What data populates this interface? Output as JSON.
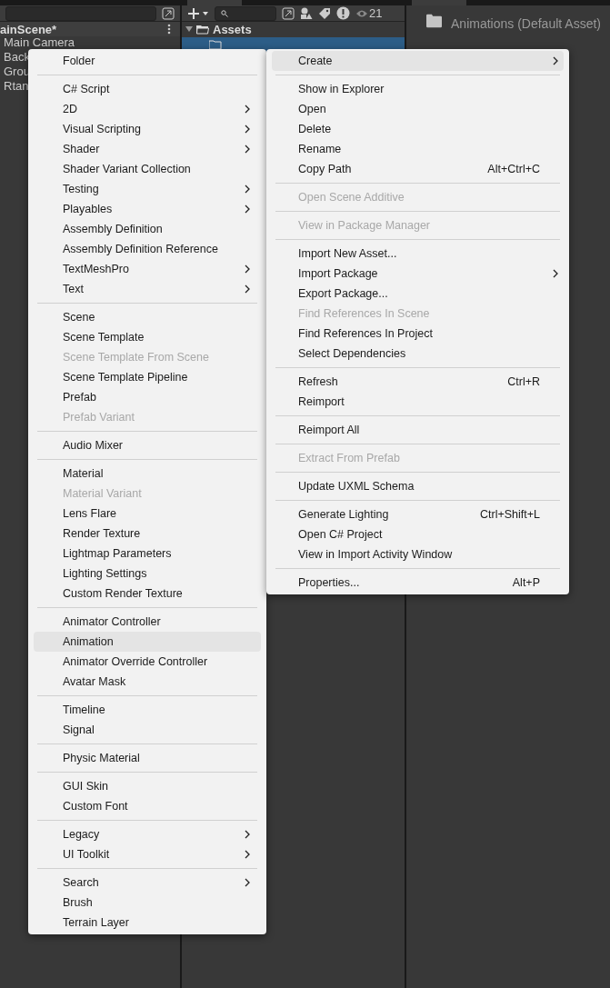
{
  "hierarchy": {
    "scene": "ainScene*",
    "items": [
      "Main Camera",
      "Back",
      "Grou",
      "Rtan"
    ]
  },
  "project": {
    "hidden_count": "21",
    "tree": [
      {
        "label": "Assets",
        "expanded": true,
        "selected": false,
        "children": [
          {
            "selected": true
          }
        ]
      }
    ]
  },
  "inspector": {
    "title": "Animations (Default Asset)"
  },
  "context_menu": {
    "sections": [
      [
        {
          "label": "Create",
          "disabled": false,
          "submenu": true,
          "selected": true
        }
      ],
      [
        {
          "label": "Show in Explorer",
          "disabled": false,
          "submenu": false,
          "selected": false
        },
        {
          "label": "Open",
          "disabled": false,
          "submenu": false,
          "selected": false
        },
        {
          "label": "Delete",
          "disabled": false,
          "submenu": false,
          "selected": false
        },
        {
          "label": "Rename",
          "disabled": false,
          "submenu": false,
          "selected": false
        },
        {
          "label": "Copy Path",
          "shortcut": "Alt+Ctrl+C",
          "disabled": false,
          "submenu": false,
          "selected": false
        }
      ],
      [
        {
          "label": "Open Scene Additive",
          "disabled": true,
          "submenu": false,
          "selected": false
        }
      ],
      [
        {
          "label": "View in Package Manager",
          "disabled": true,
          "submenu": false,
          "selected": false
        }
      ],
      [
        {
          "label": "Import New Asset...",
          "disabled": false,
          "submenu": false,
          "selected": false
        },
        {
          "label": "Import Package",
          "disabled": false,
          "submenu": true,
          "selected": false
        },
        {
          "label": "Export Package...",
          "disabled": false,
          "submenu": false,
          "selected": false
        },
        {
          "label": "Find References In Scene",
          "disabled": true,
          "submenu": false,
          "selected": false
        },
        {
          "label": "Find References In Project",
          "disabled": false,
          "submenu": false,
          "selected": false
        },
        {
          "label": "Select Dependencies",
          "disabled": false,
          "submenu": false,
          "selected": false
        }
      ],
      [
        {
          "label": "Refresh",
          "shortcut": "Ctrl+R",
          "disabled": false,
          "submenu": false,
          "selected": false
        },
        {
          "label": "Reimport",
          "disabled": false,
          "submenu": false,
          "selected": false
        }
      ],
      [
        {
          "label": "Reimport All",
          "disabled": false,
          "submenu": false,
          "selected": false
        }
      ],
      [
        {
          "label": "Extract From Prefab",
          "disabled": true,
          "submenu": false,
          "selected": false
        }
      ],
      [
        {
          "label": "Update UXML Schema",
          "disabled": false,
          "submenu": false,
          "selected": false
        }
      ],
      [
        {
          "label": "Generate Lighting",
          "shortcut": "Ctrl+Shift+L",
          "disabled": false,
          "submenu": false,
          "selected": false
        },
        {
          "label": "Open C# Project",
          "disabled": false,
          "submenu": false,
          "selected": false
        },
        {
          "label": "View in Import Activity Window",
          "disabled": false,
          "submenu": false,
          "selected": false
        }
      ],
      [
        {
          "label": "Properties...",
          "shortcut": "Alt+P",
          "disabled": false,
          "submenu": false,
          "selected": false
        }
      ]
    ]
  },
  "create_submenu": {
    "sections": [
      [
        {
          "label": "Folder",
          "disabled": false,
          "submenu": false,
          "selected": false
        }
      ],
      [
        {
          "label": "C# Script",
          "disabled": false,
          "submenu": false,
          "selected": false
        },
        {
          "label": "2D",
          "disabled": false,
          "submenu": true,
          "selected": false
        },
        {
          "label": "Visual Scripting",
          "disabled": false,
          "submenu": true,
          "selected": false
        },
        {
          "label": "Shader",
          "disabled": false,
          "submenu": true,
          "selected": false
        },
        {
          "label": "Shader Variant Collection",
          "disabled": false,
          "submenu": false,
          "selected": false
        },
        {
          "label": "Testing",
          "disabled": false,
          "submenu": true,
          "selected": false
        },
        {
          "label": "Playables",
          "disabled": false,
          "submenu": true,
          "selected": false
        },
        {
          "label": "Assembly Definition",
          "disabled": false,
          "submenu": false,
          "selected": false
        },
        {
          "label": "Assembly Definition Reference",
          "disabled": false,
          "submenu": false,
          "selected": false
        },
        {
          "label": "TextMeshPro",
          "disabled": false,
          "submenu": true,
          "selected": false
        },
        {
          "label": "Text",
          "disabled": false,
          "submenu": true,
          "selected": false
        }
      ],
      [
        {
          "label": "Scene",
          "disabled": false,
          "submenu": false,
          "selected": false
        },
        {
          "label": "Scene Template",
          "disabled": false,
          "submenu": false,
          "selected": false
        },
        {
          "label": "Scene Template From Scene",
          "disabled": true,
          "submenu": false,
          "selected": false
        },
        {
          "label": "Scene Template Pipeline",
          "disabled": false,
          "submenu": false,
          "selected": false
        },
        {
          "label": "Prefab",
          "disabled": false,
          "submenu": false,
          "selected": false
        },
        {
          "label": "Prefab Variant",
          "disabled": true,
          "submenu": false,
          "selected": false
        }
      ],
      [
        {
          "label": "Audio Mixer",
          "disabled": false,
          "submenu": false,
          "selected": false
        }
      ],
      [
        {
          "label": "Material",
          "disabled": false,
          "submenu": false,
          "selected": false
        },
        {
          "label": "Material Variant",
          "disabled": true,
          "submenu": false,
          "selected": false
        },
        {
          "label": "Lens Flare",
          "disabled": false,
          "submenu": false,
          "selected": false
        },
        {
          "label": "Render Texture",
          "disabled": false,
          "submenu": false,
          "selected": false
        },
        {
          "label": "Lightmap Parameters",
          "disabled": false,
          "submenu": false,
          "selected": false
        },
        {
          "label": "Lighting Settings",
          "disabled": false,
          "submenu": false,
          "selected": false
        },
        {
          "label": "Custom Render Texture",
          "disabled": false,
          "submenu": false,
          "selected": false
        }
      ],
      [
        {
          "label": "Animator Controller",
          "disabled": false,
          "submenu": false,
          "selected": false
        },
        {
          "label": "Animation",
          "disabled": false,
          "submenu": false,
          "selected": true
        },
        {
          "label": "Animator Override Controller",
          "disabled": false,
          "submenu": false,
          "selected": false
        },
        {
          "label": "Avatar Mask",
          "disabled": false,
          "submenu": false,
          "selected": false
        }
      ],
      [
        {
          "label": "Timeline",
          "disabled": false,
          "submenu": false,
          "selected": false
        },
        {
          "label": "Signal",
          "disabled": false,
          "submenu": false,
          "selected": false
        }
      ],
      [
        {
          "label": "Physic Material",
          "disabled": false,
          "submenu": false,
          "selected": false
        }
      ],
      [
        {
          "label": "GUI Skin",
          "disabled": false,
          "submenu": false,
          "selected": false
        },
        {
          "label": "Custom Font",
          "disabled": false,
          "submenu": false,
          "selected": false
        }
      ],
      [
        {
          "label": "Legacy",
          "disabled": false,
          "submenu": true,
          "selected": false
        },
        {
          "label": "UI Toolkit",
          "disabled": false,
          "submenu": true,
          "selected": false
        }
      ],
      [
        {
          "label": "Search",
          "disabled": false,
          "submenu": true,
          "selected": false
        },
        {
          "label": "Brush",
          "disabled": false,
          "submenu": false,
          "selected": false
        },
        {
          "label": "Terrain Layer",
          "disabled": false,
          "submenu": false,
          "selected": false
        }
      ]
    ]
  }
}
